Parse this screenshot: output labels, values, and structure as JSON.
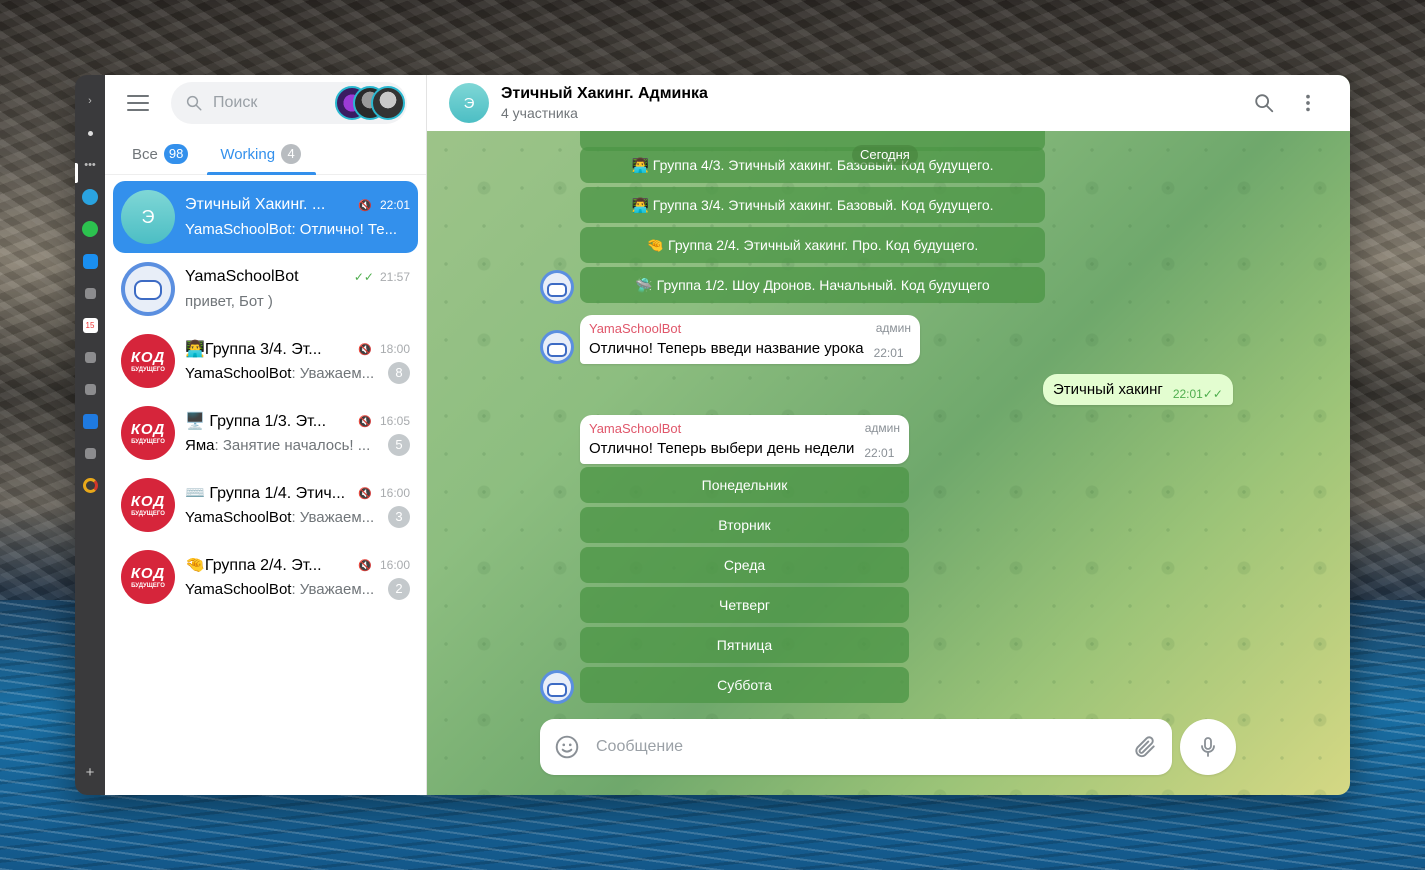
{
  "search": {
    "placeholder": "Поиск"
  },
  "tabs": [
    {
      "label": "Все",
      "count": "98"
    },
    {
      "label": "Working",
      "count": "4"
    }
  ],
  "chats": [
    {
      "name": "Этичный Хакинг. ...",
      "avatar_letter": "Э",
      "time": "22:01",
      "preview": "YamaSchoolBot: Отлично! Те...",
      "muted": true
    },
    {
      "name": "YamaSchoolBot",
      "time": "21:57",
      "preview": "привет, Бот )",
      "ticks": "✓✓"
    },
    {
      "name": "👨‍💻Группа 3/4. Эт...",
      "avatar_text": "КОД",
      "avatar_sub": "БУДУЩЕГО",
      "time": "18:00",
      "sender": "YamaSchoolBot",
      "preview": ": Уважаем...",
      "count": "8",
      "muted": true
    },
    {
      "name": "🖥️ Группа 1/3. Эт...",
      "avatar_text": "КОД",
      "avatar_sub": "БУДУЩЕГО",
      "time": "16:05",
      "sender": "Яма",
      "preview": ": Занятие началось! ...",
      "count": "5",
      "muted": true
    },
    {
      "name": "⌨️ Группа 1/4. Этич...",
      "avatar_text": "КОД",
      "avatar_sub": "БУДУЩЕГО",
      "time": "16:00",
      "sender": "YamaSchoolBot",
      "preview": ": Уважаем...",
      "count": "3",
      "muted": true
    },
    {
      "name": "🤏Группа 2/4. Эт...",
      "avatar_text": "КОД",
      "avatar_sub": "БУДУЩЕГО",
      "time": "16:00",
      "sender": "YamaSchoolBot",
      "preview": ": Уважаем...",
      "count": "2",
      "muted": true
    }
  ],
  "header": {
    "avatar_letter": "Э",
    "title": "Этичный Хакинг. Админка",
    "subtitle": "4 участника"
  },
  "date_chip": "Сегодня",
  "group_buttons": [
    "👨‍💻 Группа 4/3. Этичный хакинг. Базовый. Код будущего.",
    "👨‍💻 Группа 3/4. Этичный хакинг. Базовый. Код будущего.",
    "🤏 Группа 2/4. Этичный хакинг. Про. Код будущего.",
    "🛸 Группа 1/2. Шоу Дронов. Начальный. Код будущего"
  ],
  "msg1": {
    "from": "YamaSchoolBot",
    "role": "админ",
    "text": "Отлично! Теперь введи название урока",
    "time": "22:01"
  },
  "out1": {
    "text": "Этичный хакинг",
    "time": "22:01",
    "ticks": "✓✓"
  },
  "msg2": {
    "from": "YamaSchoolBot",
    "role": "админ",
    "text": "Отлично! Теперь выбери день недели",
    "time": "22:01"
  },
  "day_buttons": [
    "Понедельник",
    "Вторник",
    "Среда",
    "Четверг",
    "Пятница",
    "Суббота"
  ],
  "composer": {
    "placeholder": "Сообщение"
  },
  "rail": {
    "calendar_day": "15"
  }
}
